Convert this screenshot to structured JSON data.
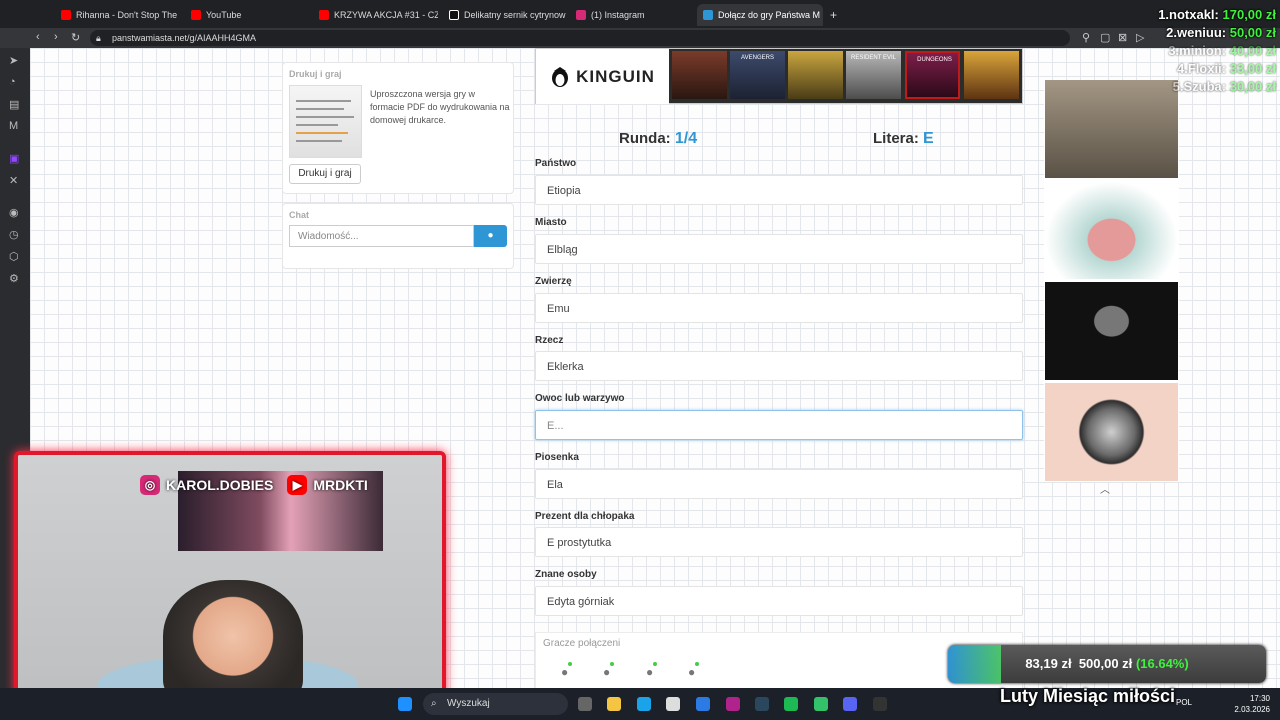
{
  "browser": {
    "tabs": [
      {
        "label": "Rihanna - Don't Stop The",
        "color": "#ff0000"
      },
      {
        "label": "YouTube",
        "color": "#ff0000"
      },
      {
        "label": "KRZYWA AKCJA #31 - CZ",
        "color": "#ff0000"
      },
      {
        "label": "Delikatny sernik cytrynow",
        "color": "#111111"
      },
      {
        "label": "(1) Instagram",
        "color": "#d62976"
      },
      {
        "label": "Dołącz do gry Państwa M",
        "color": "#2f96d6"
      }
    ],
    "new_tab": "+",
    "url": "panstwamiasta.net/g/AIAAHH4GMA"
  },
  "print_panel": {
    "title": "Drukuj i graj",
    "description": "Uproszczona wersja gry w formacie PDF do wydrukowania na domowej drukarce.",
    "button": "Drukuj i graj"
  },
  "chat_panel": {
    "title": "Chat",
    "placeholder": "Wiadomość..."
  },
  "banner": {
    "brand": "KINGUIN",
    "games": [
      {
        "label": "",
        "color": "#7a3b2a"
      },
      {
        "label": "AVENGERS",
        "color": "#3d4a6b"
      },
      {
        "label": "",
        "color": "#c9a640"
      },
      {
        "label": "RESIDENT EVIL",
        "color": "#8d8d8d"
      },
      {
        "label": "DUNGEONS",
        "color": "#7d1e4a"
      },
      {
        "label": "",
        "color": "#d9a43a"
      }
    ]
  },
  "game": {
    "round_label": "Runda:",
    "round_value": "1/4",
    "letter_label": "Litera:",
    "letter_value": "E"
  },
  "fields": [
    {
      "label": "Państwo",
      "value": "Etiopia"
    },
    {
      "label": "Miasto",
      "value": "Elbląg"
    },
    {
      "label": "Zwierzę",
      "value": "Emu"
    },
    {
      "label": "Rzecz",
      "value": "Eklerka"
    },
    {
      "label": "Owoc lub warzywo",
      "value": "E..."
    },
    {
      "label": "Piosenka",
      "value": "Ela"
    },
    {
      "label": "Prezent dla chłopaka",
      "value": "E prostytutka"
    },
    {
      "label": "Znane osoby",
      "value": "Edyta górniak"
    }
  ],
  "players": {
    "title": "Gracze połączeni",
    "count": 4
  },
  "ads": [
    {
      "color": "#8a7f6c"
    },
    {
      "color": "#b7d8d3"
    },
    {
      "color": "#1c1c1c"
    },
    {
      "color": "#f3d3c6"
    }
  ],
  "ranking": [
    {
      "name": "1.notxakl:",
      "amount": "170,00 zł"
    },
    {
      "name": "2.weniuu:",
      "amount": "50,00 zł"
    },
    {
      "name": "3.minion:",
      "amount": "40,00 zł"
    },
    {
      "name": "4.Floxii:",
      "amount": "33,00 zł"
    },
    {
      "name": "5.Szuba:",
      "amount": "30,00 zł"
    }
  ],
  "webcam": {
    "instagram": "KAROL.DOBIES",
    "youtube": "MRDKTI"
  },
  "donation_goal": {
    "current": "83,19 zł",
    "target": "500,00 zł",
    "percent_text": "(16.64%)",
    "fraction": 0.1664
  },
  "overlay_title": "Luty Miesiąc miłości",
  "taskbar": {
    "search": "Wyszukaj",
    "lang": "POL",
    "time": "17:30",
    "date": "2.03.2026"
  }
}
